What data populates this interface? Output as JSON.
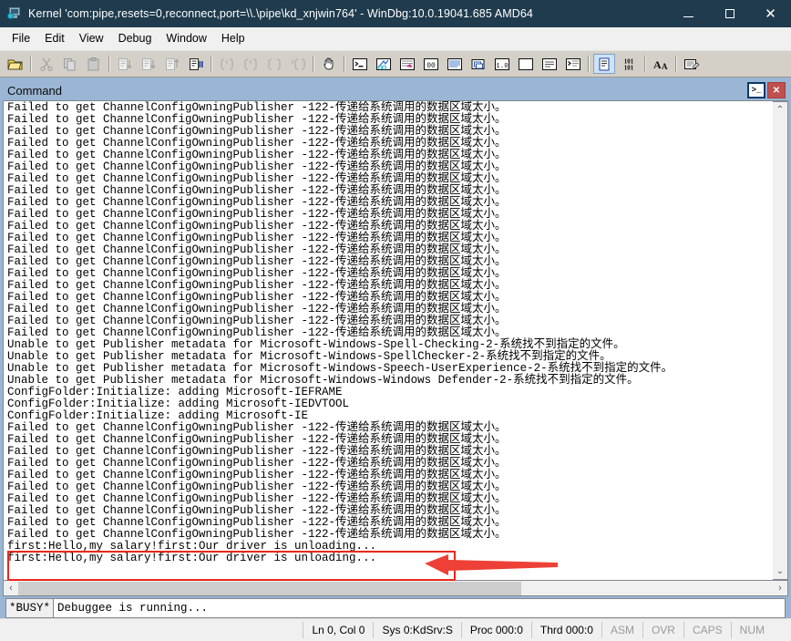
{
  "window": {
    "title": "Kernel 'com:pipe,resets=0,reconnect,port=\\\\.\\pipe\\kd_xnjwin764' - WinDbg:10.0.19041.685 AMD64",
    "icon": "windbg-kernel-icon",
    "minimize_label": "–",
    "maximize_label": "❑",
    "close_label": "✕"
  },
  "menu": {
    "items": [
      {
        "label": "File"
      },
      {
        "label": "Edit"
      },
      {
        "label": "View"
      },
      {
        "label": "Debug"
      },
      {
        "label": "Window"
      },
      {
        "label": "Help"
      }
    ]
  },
  "toolbar": {
    "buttons": [
      {
        "name": "open-file-icon",
        "enabled": true
      },
      {
        "name": "cut-icon",
        "enabled": false
      },
      {
        "name": "copy-icon",
        "enabled": false
      },
      {
        "name": "paste-icon",
        "enabled": false
      },
      {
        "name": "step-into-icon",
        "enabled": false
      },
      {
        "name": "step-over-icon",
        "enabled": false
      },
      {
        "name": "step-out-icon",
        "enabled": false
      },
      {
        "name": "run-to-cursor-icon",
        "enabled": true
      },
      {
        "name": "break-icon",
        "enabled": false
      },
      {
        "name": "restart-icon",
        "enabled": false
      },
      {
        "name": "stop-debugging-icon",
        "enabled": false
      },
      {
        "name": "detach-icon",
        "enabled": false
      },
      {
        "name": "hand-break-icon",
        "enabled": true
      },
      {
        "name": "command-window-icon",
        "enabled": true
      },
      {
        "name": "watch-window-icon",
        "enabled": true
      },
      {
        "name": "locals-window-icon",
        "enabled": true
      },
      {
        "name": "registers-window-icon",
        "enabled": true
      },
      {
        "name": "memory-window-icon",
        "enabled": true
      },
      {
        "name": "call-stack-window-icon",
        "enabled": true
      },
      {
        "name": "disassembly-window-icon",
        "enabled": true
      },
      {
        "name": "scratch-pad-window-icon",
        "enabled": true
      },
      {
        "name": "processes-threads-window-icon",
        "enabled": true
      },
      {
        "name": "command-browser-window-icon",
        "enabled": true
      },
      {
        "name": "source-window-icon",
        "selected": true,
        "enabled": true
      },
      {
        "name": "numbers-101-icon",
        "enabled": true
      },
      {
        "name": "font-size-icon",
        "enabled": true
      },
      {
        "name": "options-icon",
        "enabled": true
      }
    ]
  },
  "command_window": {
    "title": "Command",
    "restore_icon": "command-prompt-icon",
    "close_label": "✕",
    "log_lines": [
      "Failed to get ChannelConfigOwningPublisher -122-传递给系统调用的数据区域太小。",
      "Failed to get ChannelConfigOwningPublisher -122-传递给系统调用的数据区域太小。",
      "Failed to get ChannelConfigOwningPublisher -122-传递给系统调用的数据区域太小。",
      "Failed to get ChannelConfigOwningPublisher -122-传递给系统调用的数据区域太小。",
      "Failed to get ChannelConfigOwningPublisher -122-传递给系统调用的数据区域太小。",
      "Failed to get ChannelConfigOwningPublisher -122-传递给系统调用的数据区域太小。",
      "Failed to get ChannelConfigOwningPublisher -122-传递给系统调用的数据区域太小。",
      "Failed to get ChannelConfigOwningPublisher -122-传递给系统调用的数据区域太小。",
      "Failed to get ChannelConfigOwningPublisher -122-传递给系统调用的数据区域太小。",
      "Failed to get ChannelConfigOwningPublisher -122-传递给系统调用的数据区域太小。",
      "Failed to get ChannelConfigOwningPublisher -122-传递给系统调用的数据区域太小。",
      "Failed to get ChannelConfigOwningPublisher -122-传递给系统调用的数据区域太小。",
      "Failed to get ChannelConfigOwningPublisher -122-传递给系统调用的数据区域太小。",
      "Failed to get ChannelConfigOwningPublisher -122-传递给系统调用的数据区域太小。",
      "Failed to get ChannelConfigOwningPublisher -122-传递给系统调用的数据区域太小。",
      "Failed to get ChannelConfigOwningPublisher -122-传递给系统调用的数据区域太小。",
      "Failed to get ChannelConfigOwningPublisher -122-传递给系统调用的数据区域太小。",
      "Failed to get ChannelConfigOwningPublisher -122-传递给系统调用的数据区域太小。",
      "Failed to get ChannelConfigOwningPublisher -122-传递给系统调用的数据区域太小。",
      "Failed to get ChannelConfigOwningPublisher -122-传递给系统调用的数据区域太小。",
      "Unable to get Publisher metadata for Microsoft-Windows-Spell-Checking-2-系统找不到指定的文件。",
      "Unable to get Publisher metadata for Microsoft-Windows-SpellChecker-2-系统找不到指定的文件。",
      "Unable to get Publisher metadata for Microsoft-Windows-Speech-UserExperience-2-系统找不到指定的文件。",
      "Unable to get Publisher metadata for Microsoft-Windows-Windows Defender-2-系统找不到指定的文件。",
      "ConfigFolder:Initialize: adding Microsoft-IEFRAME",
      "ConfigFolder:Initialize: adding Microsoft-IEDVTOOL",
      "ConfigFolder:Initialize: adding Microsoft-IE",
      "Failed to get ChannelConfigOwningPublisher -122-传递给系统调用的数据区域太小。",
      "Failed to get ChannelConfigOwningPublisher -122-传递给系统调用的数据区域太小。",
      "Failed to get ChannelConfigOwningPublisher -122-传递给系统调用的数据区域太小。",
      "Failed to get ChannelConfigOwningPublisher -122-传递给系统调用的数据区域太小。",
      "Failed to get ChannelConfigOwningPublisher -122-传递给系统调用的数据区域太小。",
      "Failed to get ChannelConfigOwningPublisher -122-传递给系统调用的数据区域太小。",
      "Failed to get ChannelConfigOwningPublisher -122-传递给系统调用的数据区域太小。",
      "Failed to get ChannelConfigOwningPublisher -122-传递给系统调用的数据区域太小。",
      "Failed to get ChannelConfigOwningPublisher -122-传递给系统调用的数据区域太小。",
      "Failed to get ChannelConfigOwningPublisher -122-传递给系统调用的数据区域太小。",
      "first:Hello,my salary!first:Our driver is unloading...",
      "first:Hello,my salary!first:Our driver is unloading..."
    ],
    "highlighted_line": "first:Hello,my salary!first:Our driver is unloading...",
    "scroll": {
      "up_arrow": "⌃",
      "down_arrow": "⌄",
      "left_arrow": "‹",
      "right_arrow": "›"
    }
  },
  "prompt": {
    "busy_label": "*BUSY*",
    "input_value": "Debuggee is running..."
  },
  "statusbar": {
    "cells": [
      {
        "label": "Ln 0, Col 0",
        "dim": false
      },
      {
        "label": "Sys 0:KdSrv:S",
        "dim": false
      },
      {
        "label": "Proc 000:0",
        "dim": false
      },
      {
        "label": "Thrd 000:0",
        "dim": false
      },
      {
        "label": "ASM",
        "dim": true
      },
      {
        "label": "OVR",
        "dim": true
      },
      {
        "label": "CAPS",
        "dim": true
      },
      {
        "label": "NUM",
        "dim": true
      }
    ]
  },
  "annotation": {
    "box_color": "#e8291c",
    "arrow_color": "#ee4036",
    "note": "red rectangle highlighting last output line with left-pointing arrow"
  }
}
